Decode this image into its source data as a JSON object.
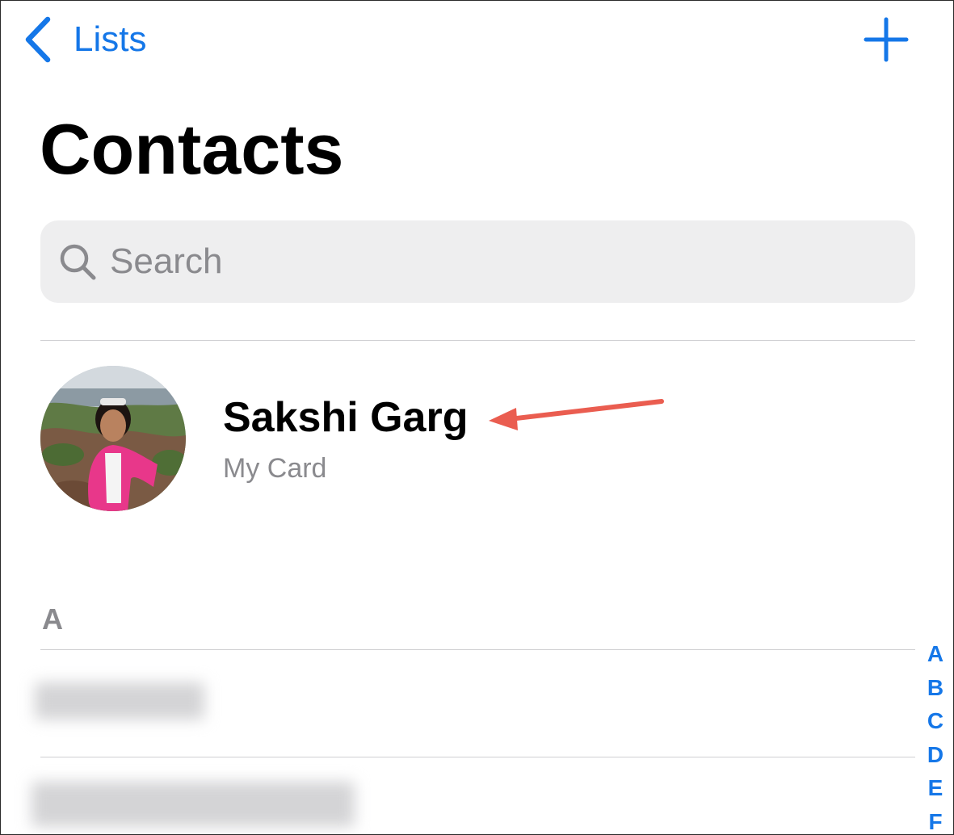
{
  "nav": {
    "back_label": "Lists",
    "add_icon": "plus-icon",
    "back_icon": "chevron-left-icon"
  },
  "page_title": "Contacts",
  "search": {
    "placeholder": "Search",
    "value": "",
    "icon": "search-icon"
  },
  "my_card": {
    "name": "Sakshi Garg",
    "subtitle": "My Card"
  },
  "section": {
    "header": "A"
  },
  "index_letters": [
    "A",
    "B",
    "C",
    "D",
    "E",
    "F"
  ],
  "colors": {
    "accent": "#1577e8",
    "annotation_arrow": "#ea5d50",
    "search_background": "#eeeeef",
    "secondary_text": "#8a8a8e"
  }
}
